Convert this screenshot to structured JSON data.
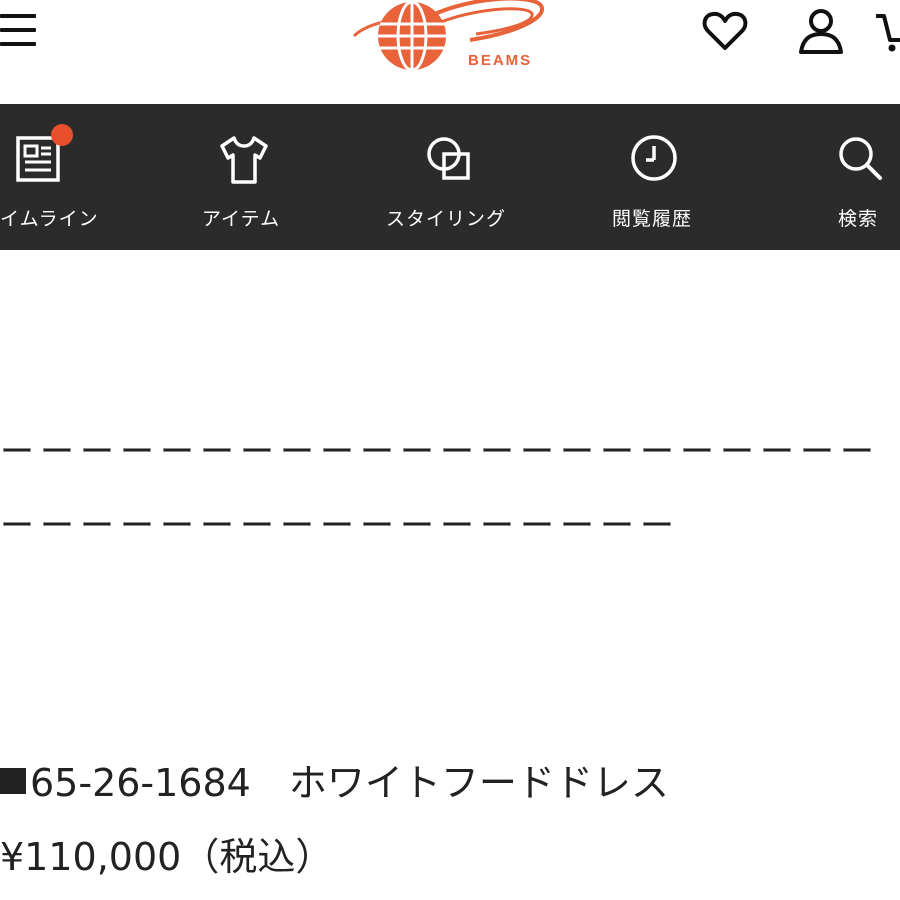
{
  "header": {
    "logo_text": "BEAMS",
    "brand_color": "#E8623A",
    "icons": [
      "menu-icon",
      "heart-icon",
      "person-icon",
      "cart-icon"
    ]
  },
  "nav": {
    "background": "#2b2b2b",
    "items": [
      {
        "label": "イムライン",
        "icon": "timeline-icon",
        "has_badge": true
      },
      {
        "label": "アイテム",
        "icon": "shirt-icon"
      },
      {
        "label": "スタイリング",
        "icon": "styling-icon"
      },
      {
        "label": "閲覧履歴",
        "icon": "clock-icon"
      },
      {
        "label": "検索",
        "icon": "search-icon"
      }
    ]
  },
  "content": {
    "dashes_line1": "ーーーーーーーーーーーーーーーーーーーーーー",
    "dashes_line2": "ーーーーーーーーーーーーーーーーー",
    "product_text": "65-26-1684　ホワイトフードドレス",
    "price_text": "¥110,000（税込）"
  }
}
